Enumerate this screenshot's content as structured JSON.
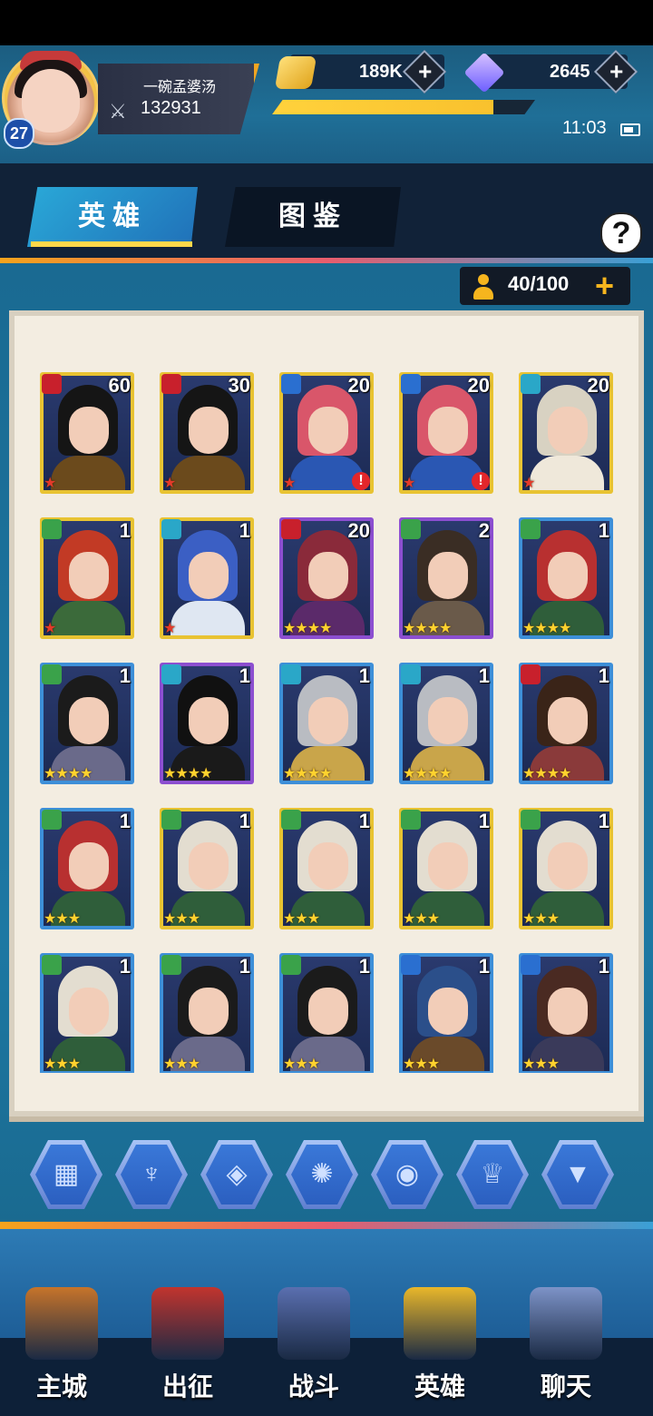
{
  "player": {
    "name": "一碗孟婆汤",
    "level": "27",
    "power": "132931"
  },
  "resources": {
    "gold": "189K",
    "gems": "2645",
    "xp_fraction": 0.84
  },
  "status": {
    "time": "11:03"
  },
  "tabs": {
    "heroes": "英雄",
    "codex": "图鉴",
    "help": "?"
  },
  "capacity": {
    "value": "40/100",
    "plus": "+"
  },
  "plus_label": "+",
  "heroes": [
    {
      "level": "60",
      "frame": "gold",
      "element": "red",
      "stars": "★",
      "star_color": "red",
      "hair": "#151515",
      "body": "#6b4a1c",
      "alert": false
    },
    {
      "level": "30",
      "frame": "gold",
      "element": "red",
      "stars": "★",
      "star_color": "red",
      "hair": "#151515",
      "body": "#6b4a1c",
      "alert": false
    },
    {
      "level": "20",
      "frame": "gold",
      "element": "blue",
      "stars": "★",
      "star_color": "red",
      "hair": "#d9566a",
      "body": "#2a57b3",
      "alert": true
    },
    {
      "level": "20",
      "frame": "gold",
      "element": "blue",
      "stars": "★",
      "star_color": "red",
      "hair": "#d9566a",
      "body": "#2a57b3",
      "alert": true
    },
    {
      "level": "20",
      "frame": "gold",
      "element": "cyan",
      "stars": "★",
      "star_color": "red",
      "hair": "#d8d2c2",
      "body": "#efe8da",
      "alert": false
    },
    {
      "level": "1",
      "frame": "gold",
      "element": "green",
      "stars": "★",
      "star_color": "red",
      "hair": "#c23a25",
      "body": "#3b6a3a",
      "alert": false
    },
    {
      "level": "1",
      "frame": "gold",
      "element": "cyan",
      "stars": "★",
      "star_color": "red",
      "hair": "#3b5fc4",
      "body": "#dfe7f2",
      "alert": false
    },
    {
      "level": "20",
      "frame": "purple",
      "element": "red",
      "stars": "★★★★",
      "star_color": "gold",
      "hair": "#8a2a3a",
      "body": "#5b2a6a",
      "alert": false
    },
    {
      "level": "2",
      "frame": "purple",
      "element": "green",
      "stars": "★★★★",
      "star_color": "gold",
      "hair": "#3a2d24",
      "body": "#6a5a4a",
      "alert": false
    },
    {
      "level": "1",
      "frame": "blue",
      "element": "green",
      "stars": "★★★★",
      "star_color": "gold",
      "hair": "#b83030",
      "body": "#2f5e3a",
      "alert": false
    },
    {
      "level": "1",
      "frame": "blue",
      "element": "green",
      "stars": "★★★★",
      "star_color": "gold",
      "hair": "#1b1b1b",
      "body": "#6a6a8a",
      "alert": false
    },
    {
      "level": "1",
      "frame": "purple",
      "element": "cyan",
      "stars": "★★★★",
      "star_color": "gold",
      "hair": "#111111",
      "body": "#1a1a1a",
      "alert": false
    },
    {
      "level": "1",
      "frame": "blue",
      "element": "cyan",
      "stars": "★★★★",
      "star_color": "gold",
      "hair": "#b9bcc2",
      "body": "#c9a54a",
      "alert": false
    },
    {
      "level": "1",
      "frame": "blue",
      "element": "cyan",
      "stars": "★★★★",
      "star_color": "gold",
      "hair": "#b9bcc2",
      "body": "#c9a54a",
      "alert": false
    },
    {
      "level": "1",
      "frame": "blue",
      "element": "red",
      "stars": "★★★★",
      "star_color": "gold",
      "hair": "#3a2418",
      "body": "#8a3a3a",
      "alert": false
    },
    {
      "level": "1",
      "frame": "blue",
      "element": "green",
      "stars": "★★★",
      "star_color": "gold",
      "hair": "#b83030",
      "body": "#2f5e3a",
      "alert": false
    },
    {
      "level": "1",
      "frame": "gold",
      "element": "green",
      "stars": "★★★",
      "star_color": "gold",
      "hair": "#e3ddd0",
      "body": "#2f5e3a",
      "alert": false
    },
    {
      "level": "1",
      "frame": "gold",
      "element": "green",
      "stars": "★★★",
      "star_color": "gold",
      "hair": "#e3ddd0",
      "body": "#2f5e3a",
      "alert": false
    },
    {
      "level": "1",
      "frame": "gold",
      "element": "green",
      "stars": "★★★",
      "star_color": "gold",
      "hair": "#e3ddd0",
      "body": "#2f5e3a",
      "alert": false
    },
    {
      "level": "1",
      "frame": "gold",
      "element": "green",
      "stars": "★★★",
      "star_color": "gold",
      "hair": "#e3ddd0",
      "body": "#2f5e3a",
      "alert": false
    },
    {
      "level": "1",
      "frame": "blue",
      "element": "green",
      "stars": "★★★",
      "star_color": "gold",
      "hair": "#e3ddd0",
      "body": "#2f5e3a",
      "alert": false
    },
    {
      "level": "1",
      "frame": "blue",
      "element": "green",
      "stars": "★★★",
      "star_color": "gold",
      "hair": "#1b1b1b",
      "body": "#6a6a8a",
      "alert": false
    },
    {
      "level": "1",
      "frame": "blue",
      "element": "green",
      "stars": "★★★",
      "star_color": "gold",
      "hair": "#1b1b1b",
      "body": "#6a6a8a",
      "alert": false
    },
    {
      "level": "1",
      "frame": "blue",
      "element": "blue",
      "stars": "★★★",
      "star_color": "gold",
      "hair": "#2b4f8a",
      "body": "#6a4a2a",
      "alert": false
    },
    {
      "level": "1",
      "frame": "blue",
      "element": "blue",
      "stars": "★★★",
      "star_color": "gold",
      "hair": "#4a2a22",
      "body": "#3a3a5a",
      "alert": false
    }
  ],
  "filters": [
    {
      "name": "all-filter",
      "glyph": "▦"
    },
    {
      "name": "faction-1-filter",
      "glyph": "♆"
    },
    {
      "name": "faction-2-filter",
      "glyph": "◈"
    },
    {
      "name": "faction-3-filter",
      "glyph": "✺"
    },
    {
      "name": "faction-4-filter",
      "glyph": "◉"
    },
    {
      "name": "faction-5-filter",
      "glyph": "♕"
    },
    {
      "name": "faction-6-filter",
      "glyph": "▼"
    }
  ],
  "nav": [
    {
      "label": "主城",
      "icon": "book-icon",
      "color": "#c7742a"
    },
    {
      "label": "出征",
      "icon": "ship-icon",
      "color": "#c2342e"
    },
    {
      "label": "战斗",
      "icon": "swords-icon",
      "color": "#5a6fb0"
    },
    {
      "label": "英雄",
      "icon": "helmet-icon",
      "color": "#e9b72a"
    },
    {
      "label": "聊天",
      "icon": "chat-icon",
      "color": "#7d93c8"
    }
  ],
  "colors": {
    "element_red": "#c8202c",
    "element_blue": "#2a6fd0",
    "element_cyan": "#2aa7c8",
    "element_green": "#3aa24a"
  }
}
